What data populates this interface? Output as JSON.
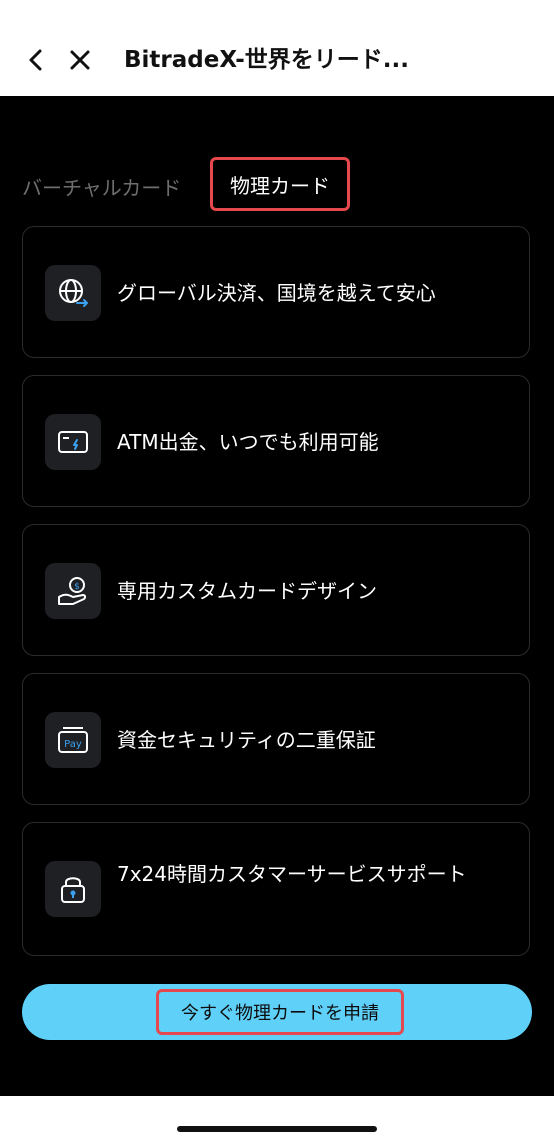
{
  "header": {
    "title": "BitradeX-世界をリード..."
  },
  "tabs": [
    {
      "label": "バーチャルカード",
      "selected": false
    },
    {
      "label": "物理カード",
      "selected": true
    }
  ],
  "features": [
    {
      "label": "グローバル決済、国境を越えて安心",
      "icon": "globe-transfer-icon"
    },
    {
      "label": "ATM出金、いつでも利用可能",
      "icon": "card-atm-icon"
    },
    {
      "label": "専用カスタムカードデザイン",
      "icon": "hand-coin-icon"
    },
    {
      "label": "資金セキュリティの二重保証",
      "icon": "pay-card-icon"
    },
    {
      "label": "7x24時間カスタマーサービスサポート",
      "icon": "lock-icon"
    }
  ],
  "apply_button": {
    "label": "今すぐ物理カードを申請"
  },
  "colors": {
    "accent": "#5fd1f9",
    "highlight_border": "#e5484d",
    "background": "#000000",
    "card_border": "#2b2b2b",
    "icon_blue": "#3aa0f0"
  }
}
